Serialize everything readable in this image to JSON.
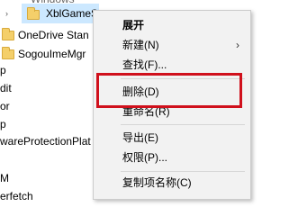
{
  "tree": {
    "top_partial": "Windows",
    "selected_key": "XblGameSa",
    "items": [
      "OneDrive Stan",
      "SogouImeMgr"
    ],
    "left_fragments": [
      "p",
      "dit",
      "or",
      "p",
      "wareProtectionPlat",
      "M",
      "erfetch"
    ]
  },
  "context_menu": {
    "expand": "展开",
    "new": "新建(N)",
    "new_arrow": "›",
    "find": "查找(F)...",
    "delete": "删除(D)",
    "rename": "重命名(R)",
    "export": "导出(E)",
    "permissions": "权限(P)...",
    "copy_key_name": "复制项名称(C)"
  },
  "colors": {
    "menu_background": "#f2f2f2",
    "highlight_box": "#d0101c",
    "selection": "#cce8ff",
    "folder": "#f4cf6a"
  }
}
